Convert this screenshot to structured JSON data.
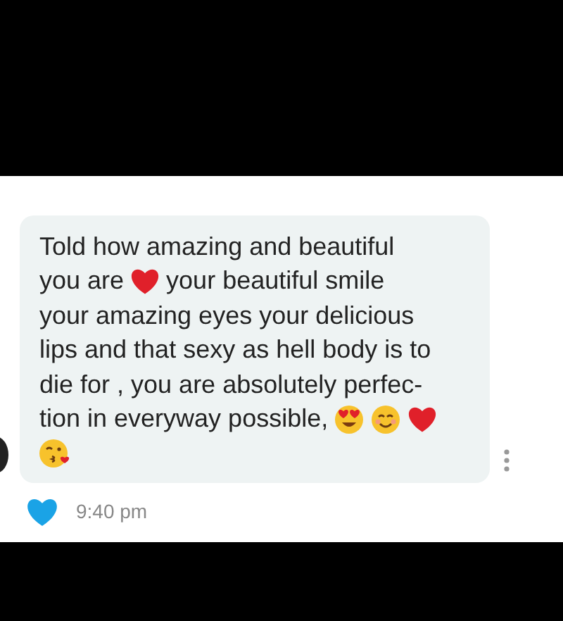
{
  "message": {
    "lines": [
      [
        {
          "kind": "text",
          "text": "Told how amazing and beautiful"
        }
      ],
      [
        {
          "kind": "text",
          "text": "you are"
        },
        {
          "kind": "heart"
        },
        {
          "kind": "text",
          "text": "your beautiful smile"
        }
      ],
      [
        {
          "kind": "text",
          "text": "your amazing eyes your delicious"
        }
      ],
      [
        {
          "kind": "text",
          "text": "lips and that sexy as hell body is to"
        }
      ],
      [
        {
          "kind": "text",
          "text": "die for , you are absolutely perfec-"
        }
      ],
      [
        {
          "kind": "text",
          "text": "tion in everyway possible,"
        },
        {
          "kind": "heart_eyes"
        },
        {
          "kind": "smile"
        },
        {
          "kind": "heart"
        }
      ],
      [
        {
          "kind": "kiss"
        }
      ]
    ],
    "time": "9:40 pm",
    "liked": true
  }
}
